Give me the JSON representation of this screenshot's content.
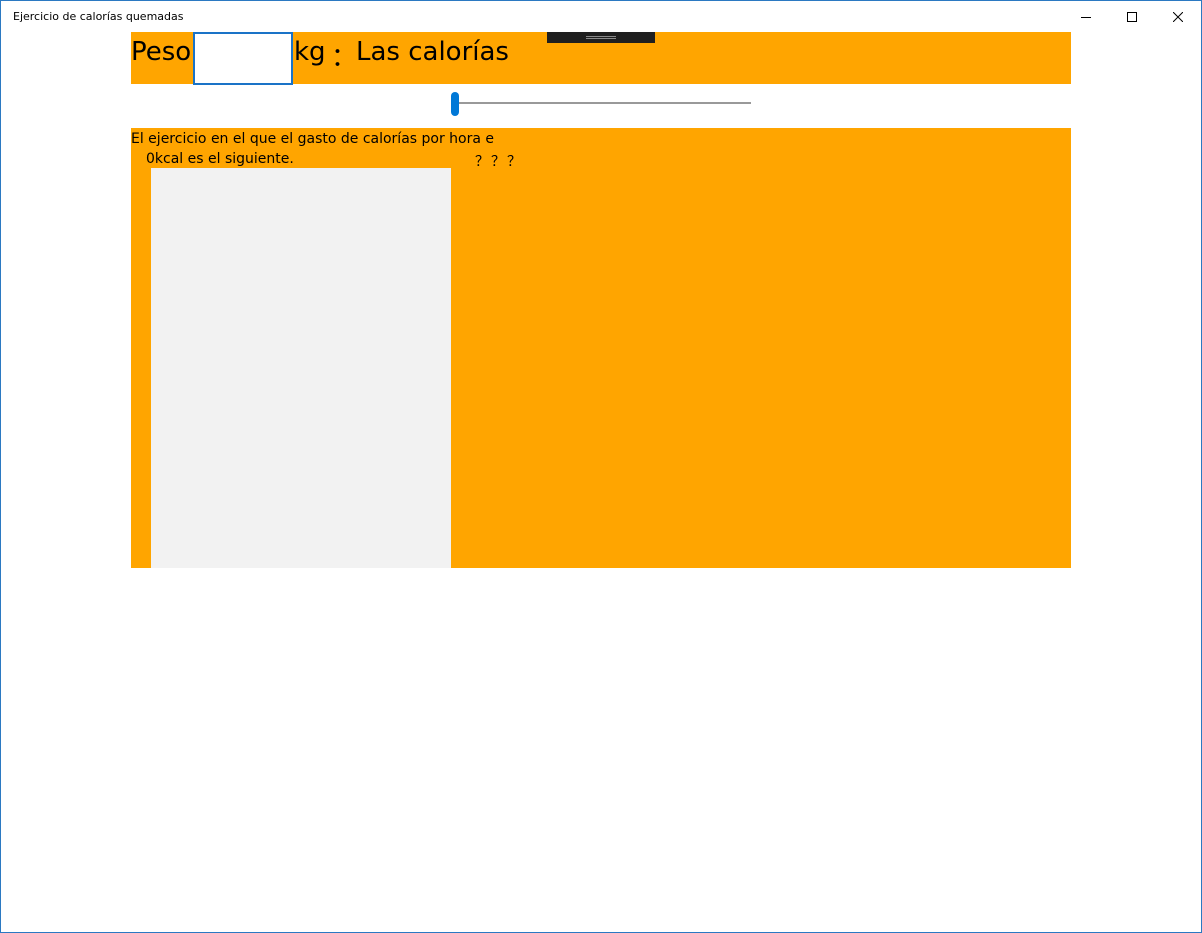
{
  "window": {
    "title": "Ejercicio de calorías quemadas",
    "controls": [
      "minimize",
      "maximize",
      "close"
    ]
  },
  "header": {
    "peso_label": "Peso",
    "weight_value": "",
    "kg_label": "kg",
    "colon": "：",
    "calorias_label": "Las calorías"
  },
  "slider": {
    "value": 0
  },
  "main": {
    "desc_line1": "El ejercicio en el que el gasto de calorías por hora e",
    "desc_line2": "0kcal es el siguiente.",
    "unknown": "？？？",
    "exercise_items": []
  },
  "colors": {
    "accent": "#0078d7",
    "panel": "#ffa500",
    "list_bg": "#f2f2f2"
  }
}
